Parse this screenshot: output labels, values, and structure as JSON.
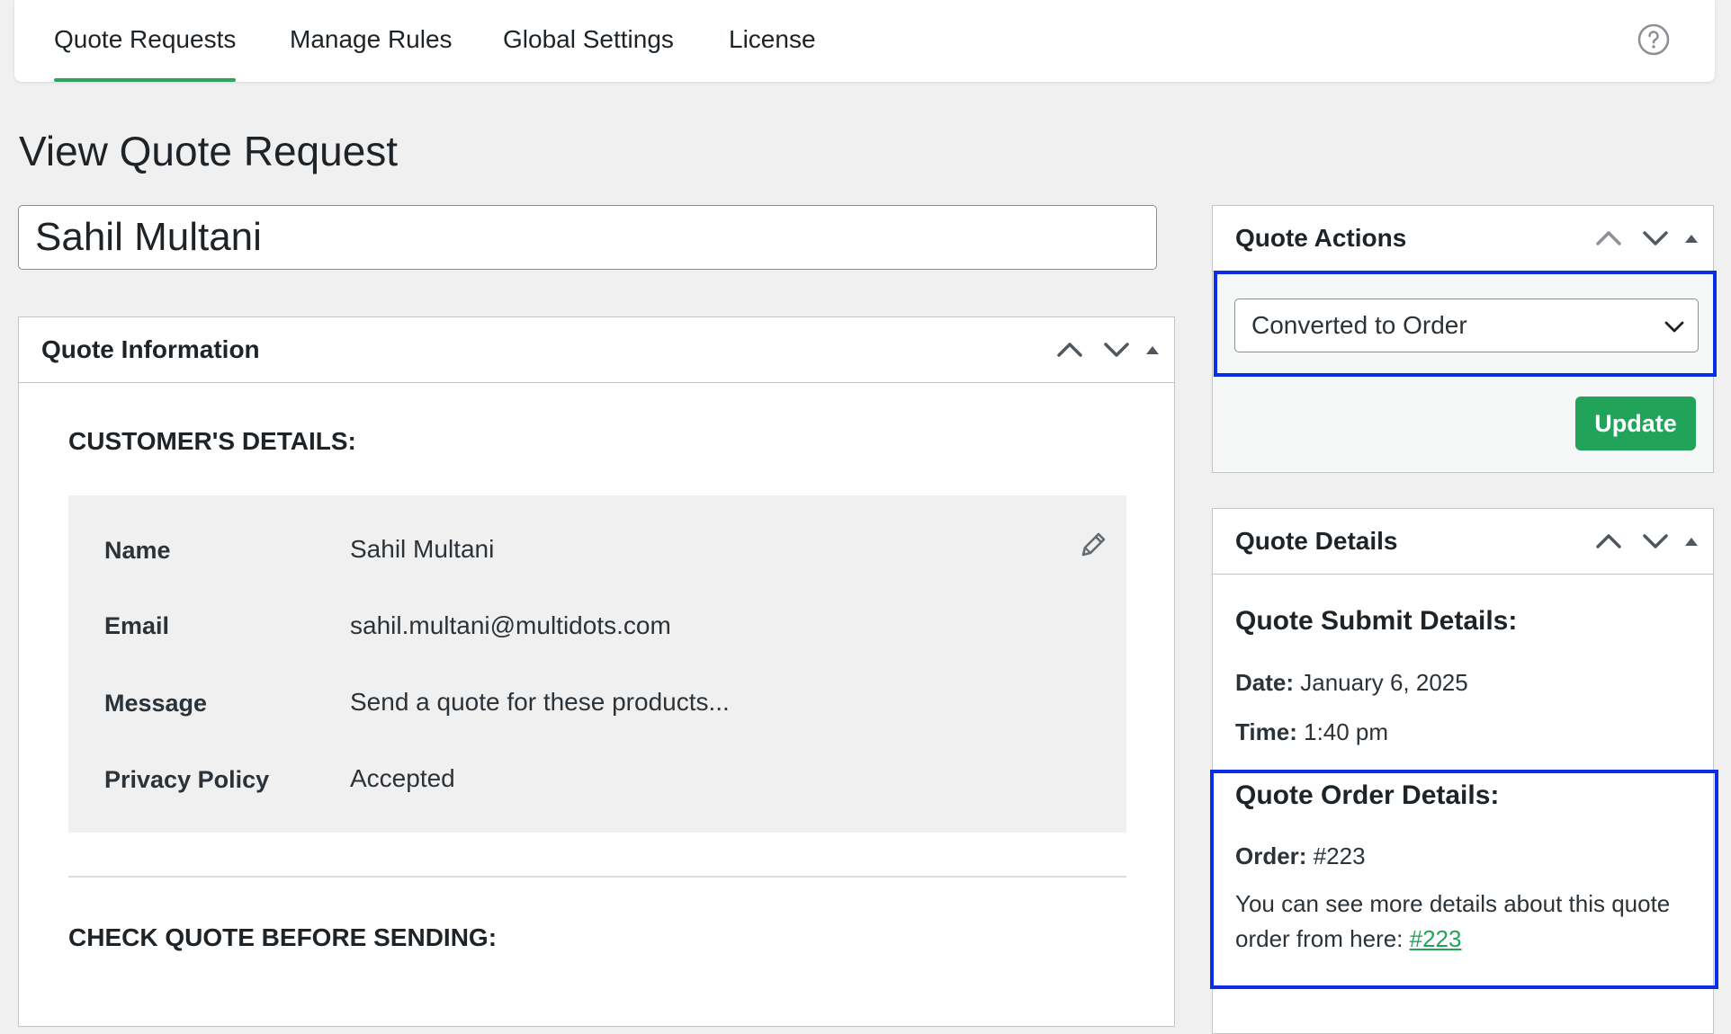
{
  "nav": {
    "tabs": [
      {
        "label": "Quote Requests",
        "active": true
      },
      {
        "label": "Manage Rules",
        "active": false
      },
      {
        "label": "Global Settings",
        "active": false
      },
      {
        "label": "License",
        "active": false
      }
    ],
    "help_icon": "question-circle-icon"
  },
  "page": {
    "title": "View Quote Request",
    "post_title": "Sahil Multani"
  },
  "quote_info": {
    "title": "Quote Information",
    "customer_heading": "CUSTOMER'S DETAILS:",
    "fields": [
      {
        "label": "Name",
        "value": "Sahil Multani"
      },
      {
        "label": "Email",
        "value": "sahil.multani@multidots.com"
      },
      {
        "label": "Message",
        "value": "Send a quote for these products..."
      },
      {
        "label": "Privacy Policy",
        "value": "Accepted"
      }
    ],
    "check_heading": "CHECK QUOTE BEFORE SENDING:"
  },
  "quote_actions": {
    "title": "Quote Actions",
    "status_selected": "Converted to Order",
    "update_label": "Update"
  },
  "quote_details": {
    "title": "Quote Details",
    "submit_heading": "Quote Submit Details:",
    "date_label": "Date:",
    "date_value": "January 6, 2025",
    "time_label": "Time:",
    "time_value": "1:40 pm",
    "order_heading": "Quote Order Details:",
    "order_label": "Order:",
    "order_value": "#223",
    "more_text": "You can see more details about this quote order from here:",
    "order_link": "#223"
  },
  "colors": {
    "accent_green": "#21a35a",
    "highlight_blue": "#0a2ee6",
    "background": "#f0f0f1"
  }
}
